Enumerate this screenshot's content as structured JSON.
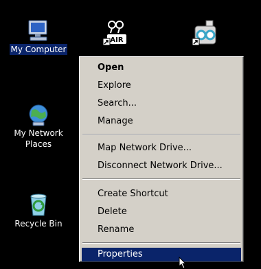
{
  "desktop": {
    "icons": [
      {
        "label_line1": "My Computer",
        "label_line2": "",
        "icon": "my-computer-icon",
        "selected": true
      },
      {
        "label_line1": "My Network",
        "label_line2": "Places",
        "icon": "network-places-icon"
      },
      {
        "label_line1": "Recycle Bin",
        "label_line2": "",
        "icon": "recycle-bin-icon"
      },
      {
        "label_line1": "",
        "icon": "air-shortcut-icon"
      },
      {
        "label_line1": "",
        "icon": "program-shortcut-icon"
      }
    ]
  },
  "context_menu": {
    "items": [
      {
        "label": "Open",
        "bold": true
      },
      {
        "label": "Explore"
      },
      {
        "label": "Search..."
      },
      {
        "label": "Manage"
      },
      {
        "label": "Map Network Drive..."
      },
      {
        "label": "Disconnect Network Drive..."
      },
      {
        "label": "Create Shortcut"
      },
      {
        "label": "Delete"
      },
      {
        "label": "Rename"
      },
      {
        "label": "Properties",
        "highlighted": true
      }
    ]
  },
  "colors": {
    "desktop_bg": "#000000",
    "menu_bg": "#d4d0c8",
    "selection": "#0a246a"
  }
}
